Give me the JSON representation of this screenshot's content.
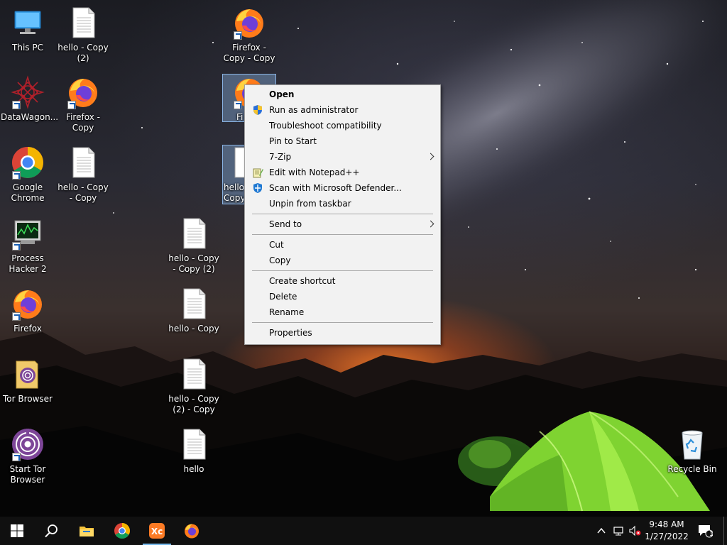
{
  "desktop": {
    "icons": [
      {
        "label": "This PC",
        "icon": "this-pc-icon"
      },
      {
        "label": "hello - Copy (2)",
        "icon": "text-file-icon"
      },
      {
        "label": "Firefox - Copy - Copy",
        "icon": "firefox-icon"
      },
      {
        "label": "DataWagon...",
        "icon": "datawagon-icon"
      },
      {
        "label": "Firefox - Copy",
        "icon": "firefox-icon"
      },
      {
        "label": "Fi",
        "icon": "firefox-icon"
      },
      {
        "label": "Google Chrome",
        "icon": "chrome-icon"
      },
      {
        "label": "hello - Copy - Copy",
        "icon": "text-file-icon"
      },
      {
        "label": "hello - Copy",
        "icon": "text-file-icon"
      },
      {
        "label": "Process Hacker 2",
        "icon": "process-hacker-icon"
      },
      {
        "label": "hello - Copy - Copy (2)",
        "icon": "text-file-icon"
      },
      {
        "label": "Firefox",
        "icon": "firefox-icon"
      },
      {
        "label": "hello - Copy",
        "icon": "text-file-icon"
      },
      {
        "label": "Tor Browser",
        "icon": "tor-folder-icon"
      },
      {
        "label": "hello - Copy (2) - Copy",
        "icon": "text-file-icon"
      },
      {
        "label": "Start Tor Browser",
        "icon": "tor-icon"
      },
      {
        "label": "hello",
        "icon": "text-file-icon"
      },
      {
        "label": "Recycle Bin",
        "icon": "recycle-bin-icon"
      }
    ]
  },
  "context_menu": {
    "items": [
      {
        "label": "Open",
        "bold": true
      },
      {
        "label": "Run as administrator",
        "icon": "uac-shield-icon"
      },
      {
        "label": "Troubleshoot compatibility"
      },
      {
        "label": "Pin to Start"
      },
      {
        "label": "7-Zip",
        "submenu": true
      },
      {
        "label": "Edit with Notepad++",
        "icon": "notepadpp-icon"
      },
      {
        "label": "Scan with Microsoft Defender...",
        "icon": "defender-icon"
      },
      {
        "label": "Unpin from taskbar"
      },
      {
        "label": "Send to",
        "submenu": true
      },
      {
        "label": "Cut"
      },
      {
        "label": "Copy"
      },
      {
        "label": "Create shortcut"
      },
      {
        "label": "Delete"
      },
      {
        "label": "Rename"
      },
      {
        "label": "Properties"
      }
    ]
  },
  "taskbar": {
    "pinned": [
      "windows-start-icon",
      "search-icon",
      "file-explorer-icon",
      "chrome-icon",
      "xampp-icon",
      "firefox-icon"
    ],
    "tray": [
      "chevron-up-icon",
      "network-icon",
      "volume-muted-icon"
    ],
    "clock": {
      "time": "9:48 AM",
      "date": "1/27/2022"
    },
    "notifications": {
      "count": "1"
    }
  },
  "colors": {
    "menu_bg": "#f2f2f2",
    "taskbar_bg": "#101010",
    "accent": "#76b9ed",
    "tent_green": "#8ee03a"
  }
}
